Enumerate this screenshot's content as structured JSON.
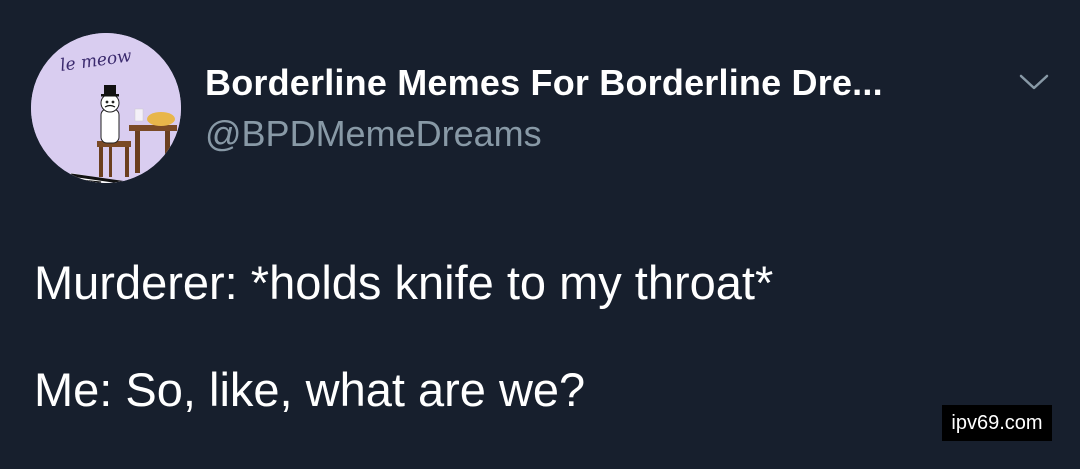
{
  "profile": {
    "display_name": "Borderline Memes For Borderline Dre...",
    "handle": "@BPDMemeDreams",
    "avatar_text": "le meow",
    "menu_icon": "chevron-down-icon"
  },
  "tweet": {
    "lines": [
      "Murderer: *holds knife to my throat*",
      "Me: So, like, what are we?"
    ]
  },
  "watermark": {
    "text": "ipv69.com"
  },
  "colors": {
    "background": "#171f2d",
    "text_primary": "#ffffff",
    "text_secondary": "#8899a6",
    "avatar_bg": "#d9cdf0"
  }
}
